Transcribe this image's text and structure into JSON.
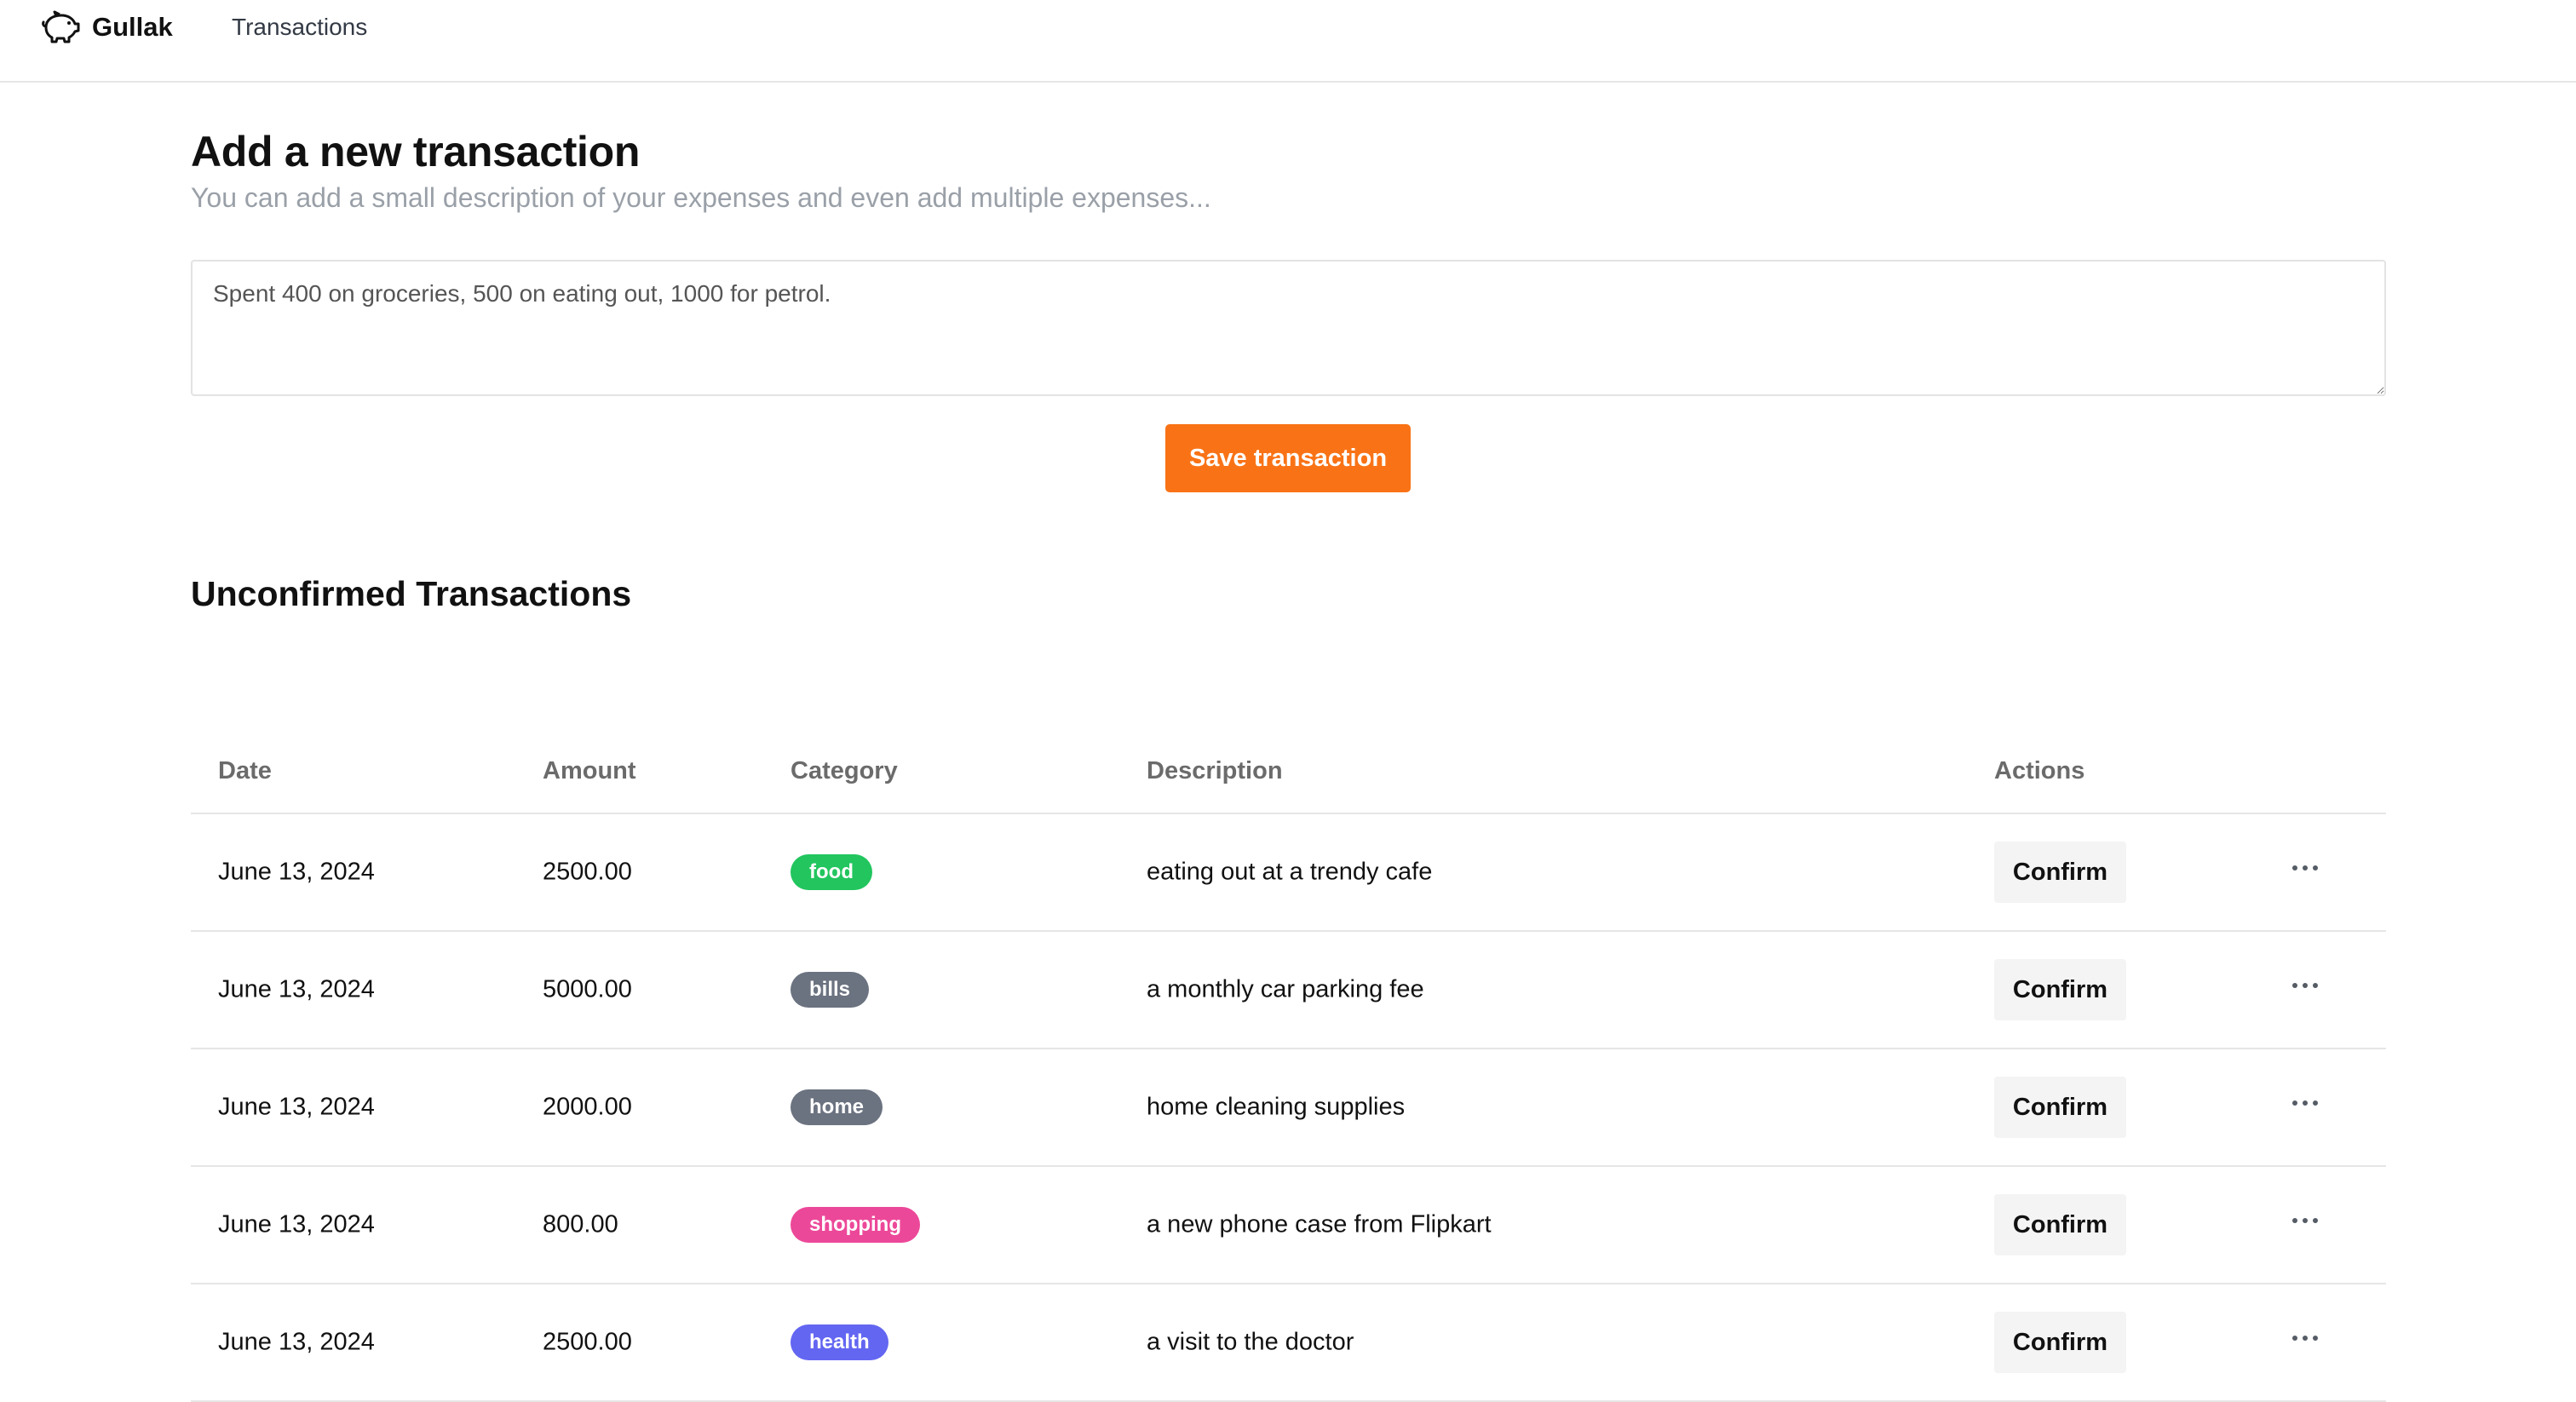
{
  "nav": {
    "brand": "Gullak",
    "brand_icon": "piggy-bank-icon",
    "links": [
      "Transactions"
    ]
  },
  "form": {
    "title": "Add a new transaction",
    "subtitle": "You can add a small description of your expenses and even add multiple expenses...",
    "input_value": "Spent 400 on groceries, 500 on eating out, 1000 for petrol.",
    "save_label": "Save transaction",
    "save_color": "#f97316"
  },
  "unconfirmed": {
    "title": "Unconfirmed Transactions",
    "columns": [
      "Date",
      "Amount",
      "Category",
      "Description",
      "Actions"
    ],
    "confirm_label": "Confirm",
    "more_icon": "more-horizontal-icon",
    "rows": [
      {
        "date": "June 13, 2024",
        "amount": "2500.00",
        "category": "food",
        "category_color": "#22c55e",
        "description": "eating out at a trendy cafe"
      },
      {
        "date": "June 13, 2024",
        "amount": "5000.00",
        "category": "bills",
        "category_color": "#6b7280",
        "description": "a monthly car parking fee"
      },
      {
        "date": "June 13, 2024",
        "amount": "2000.00",
        "category": "home",
        "category_color": "#6b7280",
        "description": "home cleaning supplies"
      },
      {
        "date": "June 13, 2024",
        "amount": "800.00",
        "category": "shopping",
        "category_color": "#ec4899",
        "description": "a new phone case from Flipkart"
      },
      {
        "date": "June 13, 2024",
        "amount": "2500.00",
        "category": "health",
        "category_color": "#6366f1",
        "description": "a visit to the doctor"
      }
    ]
  }
}
